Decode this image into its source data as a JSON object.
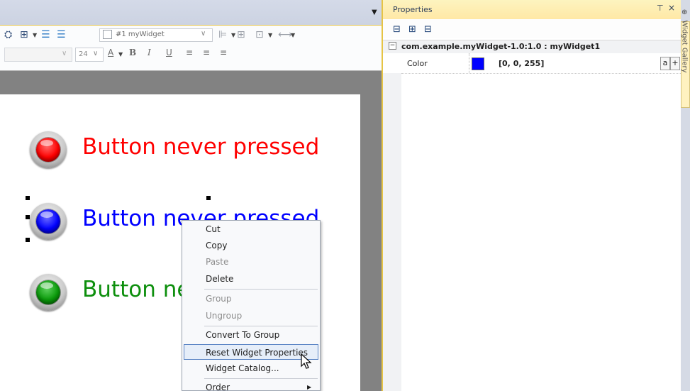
{
  "toolbar": {
    "widget_select_value": "#1 myWidget",
    "font_size_value": "24",
    "font_color_label": "A",
    "bold_label": "B",
    "italic_label": "I",
    "underline_label": "U",
    "align_icons": [
      "align-left-icon",
      "align-center-icon",
      "align-right-icon"
    ]
  },
  "canvas": {
    "widgets": [
      {
        "label": "Button never pressed",
        "color": "#ff0000"
      },
      {
        "label": "Button never pressed",
        "color": "#0000ff"
      },
      {
        "label": "Button never pressed",
        "color": "#008000"
      }
    ]
  },
  "context_menu": {
    "items": [
      {
        "label": "Cut",
        "enabled": true
      },
      {
        "label": "Copy",
        "enabled": true
      },
      {
        "label": "Paste",
        "enabled": false
      },
      {
        "label": "Delete",
        "enabled": true
      },
      {
        "label": "Group",
        "enabled": false
      },
      {
        "label": "Ungroup",
        "enabled": false
      },
      {
        "label": "Convert To Group",
        "enabled": true
      },
      {
        "label": "Reset Widget Properties",
        "enabled": true,
        "highlighted": true
      },
      {
        "label": "Widget Catalog...",
        "enabled": true
      },
      {
        "label": "Order",
        "enabled": true,
        "has_submenu": true
      }
    ]
  },
  "properties": {
    "title": "Properties",
    "pin_label": "ᵖ",
    "close_label": "×",
    "category": "com.example.myWidget-1.0:1.0 : myWidget1",
    "category_toggle": "−",
    "rows": [
      {
        "name": "Color",
        "value": "[0, 0, 255]",
        "swatch": "#0000ff"
      }
    ],
    "btn_a": "a",
    "btn_plus": "+"
  },
  "gallery": {
    "tab_label": "Widget Gallery"
  },
  "colors": {
    "accent_yellow": "#e6c445",
    "selection_blue": "#5a84c4"
  }
}
